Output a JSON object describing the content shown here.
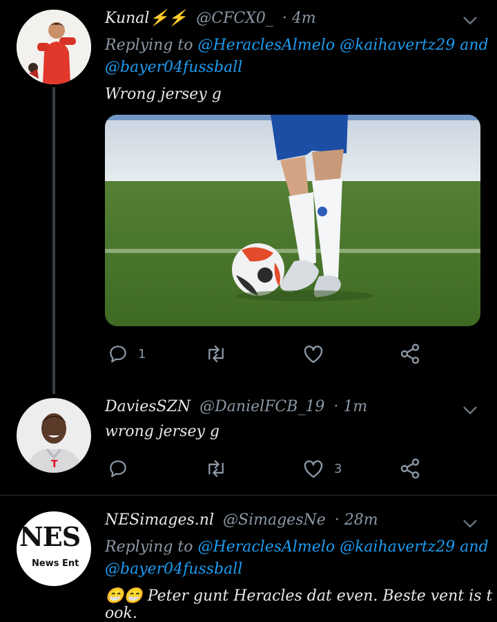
{
  "tweets": [
    {
      "name": "Kunal⚡⚡",
      "handle": "@CFCX0_",
      "time": "· 4m",
      "replying_label": "Replying to",
      "mentions": [
        "@HeraclesAlmelo",
        "@kaihavertz29"
      ],
      "and_label": "and",
      "mention_last": "@bayer04fussball",
      "text": "Wrong jersey g",
      "reply_count": "1",
      "like_count": ""
    },
    {
      "name": "DaviesSZN",
      "handle": "@DanielFCB_19",
      "time": "· 1m",
      "text": "wrong jersey g",
      "reply_count": "",
      "like_count": "3"
    },
    {
      "name": "NESimages.nl",
      "handle": "@SimagesNe",
      "time": "· 28m",
      "replying_label": "Replying to",
      "mentions": [
        "@HeraclesAlmelo",
        "@kaihavertz29"
      ],
      "and_label": "and",
      "mention_last": "@bayer04fussball",
      "text": "😁😁 Peter gunt Heracles dat even.  Beste vent is t ook.",
      "avatar_text_big": "NES",
      "avatar_text_small": "News Ent"
    }
  ],
  "icons": {
    "reply": "reply-icon",
    "retweet": "retweet-icon",
    "like": "heart-icon",
    "share": "share-icon",
    "caret": "chevron-down-icon"
  },
  "colors": {
    "background": "#000000",
    "link": "#1d9bf0",
    "muted": "#8b98a5",
    "text": "#e7e9ea"
  }
}
